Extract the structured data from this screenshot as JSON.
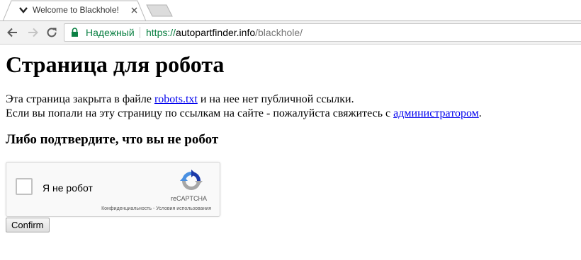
{
  "browser": {
    "tab": {
      "title": "Welcome to Blackhole!"
    },
    "omnibox": {
      "secure_label": "Надежный",
      "url_scheme": "https://",
      "url_host": "autopartfinder.info",
      "url_path": "/blackhole/"
    }
  },
  "page": {
    "heading": "Страница для робота",
    "para_line1_before": "Эта страница закрыта в файле ",
    "para_line1_link": "robots.txt",
    "para_line1_after": " и на нее нет публичной ссылки.",
    "para_line2_before": "Если вы попали на эту страницу по ссылкам на сайте - пожалуйста свяжитесь с ",
    "para_line2_link": "администратором",
    "para_line2_after": ".",
    "subheading": "Либо подтвердите, что вы не робот",
    "recaptcha": {
      "label": "Я не робот",
      "brand": "reCAPTCHA",
      "terms": "Конфиденциальность - Условия использования"
    },
    "confirm_label": "Confirm"
  },
  "colors": {
    "secure_green": "#0b8043",
    "link": "#0000ee",
    "recaptcha_blue": "#4a90e2",
    "recaptcha_gray": "#a6a6a6"
  },
  "icons": [
    "chevron-down-icon",
    "close-icon",
    "back-arrow-icon",
    "forward-arrow-icon",
    "reload-icon",
    "lock-icon",
    "recaptcha-logo-icon"
  ]
}
